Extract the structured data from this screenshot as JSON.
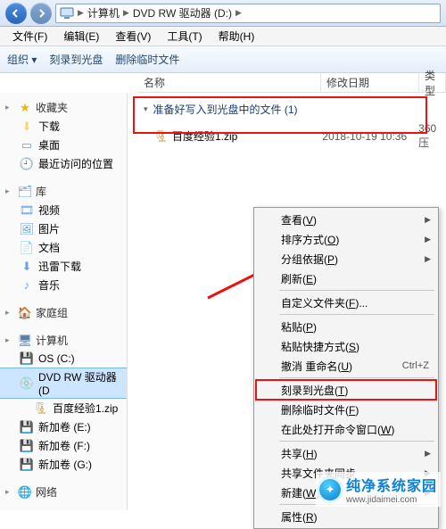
{
  "breadcrumb": {
    "computer": "计算机",
    "drive": "DVD RW 驱动器 (D:)"
  },
  "menubar": {
    "file": "文件(F)",
    "edit": "编辑(E)",
    "view": "查看(V)",
    "tools": "工具(T)",
    "help": "帮助(H)"
  },
  "toolbar": {
    "organize": "组织 ▾",
    "burn": "刻录到光盘",
    "delete_temp": "删除临时文件"
  },
  "columns": {
    "name": "名称",
    "date": "修改日期",
    "type": "类型"
  },
  "nav": {
    "favorites": "收藏夹",
    "downloads": "下载",
    "desktop": "桌面",
    "recent": "最近访问的位置",
    "libraries": "库",
    "videos": "视频",
    "pictures": "图片",
    "documents": "文档",
    "xunlei": "迅雷下载",
    "music": "音乐",
    "homegroup": "家庭组",
    "computer": "计算机",
    "osc": "OS (C:)",
    "dvd": "DVD RW 驱动器 (D",
    "zip": "百度经验1.zip",
    "vol_e": "新加卷 (E:)",
    "vol_f": "新加卷 (F:)",
    "vol_g": "新加卷 (G:)",
    "network": "网络"
  },
  "content": {
    "group_header": "准备好写入到光盘中的文件 (1)",
    "file_name": "百度经验1.zip",
    "file_date": "2018-10-19 10:36",
    "file_type": "360压"
  },
  "ctx": {
    "view": "查看(",
    "view_u": "V",
    "view_end": ")",
    "sort": "排序方式(",
    "sort_u": "O",
    "sort_end": ")",
    "group": "分组依据(",
    "group_u": "P",
    "group_end": ")",
    "refresh": "刷新(",
    "refresh_u": "E",
    "refresh_end": ")",
    "custom": "自定义文件夹(",
    "custom_u": "F",
    "custom_end": ")...",
    "paste": "粘贴(",
    "paste_u": "P",
    "paste_end": ")",
    "paste_shortcut": "粘贴快捷方式(",
    "paste_shortcut_u": "S",
    "paste_shortcut_end": ")",
    "undo": "撤消 重命名(",
    "undo_u": "U",
    "undo_end": ")",
    "undo_key": "Ctrl+Z",
    "burn": "刻录到光盘(",
    "burn_u": "T",
    "burn_end": ")",
    "delete_temp": "删除临时文件(",
    "delete_temp_u": "F",
    "delete_temp_end": ")",
    "open_cmd": "在此处打开命令窗口(",
    "open_cmd_u": "W",
    "open_cmd_end": ")",
    "share": "共享(",
    "share_u": "H",
    "share_end": ")",
    "sync": "共享文件夹同步",
    "new": "新建(",
    "new_u": "W",
    "new_end": ")",
    "props": "属性(",
    "props_u": "R",
    "props_end": ")"
  },
  "watermark": {
    "line1": "纯净系统家园",
    "line2": "www.jidaimei.com"
  }
}
